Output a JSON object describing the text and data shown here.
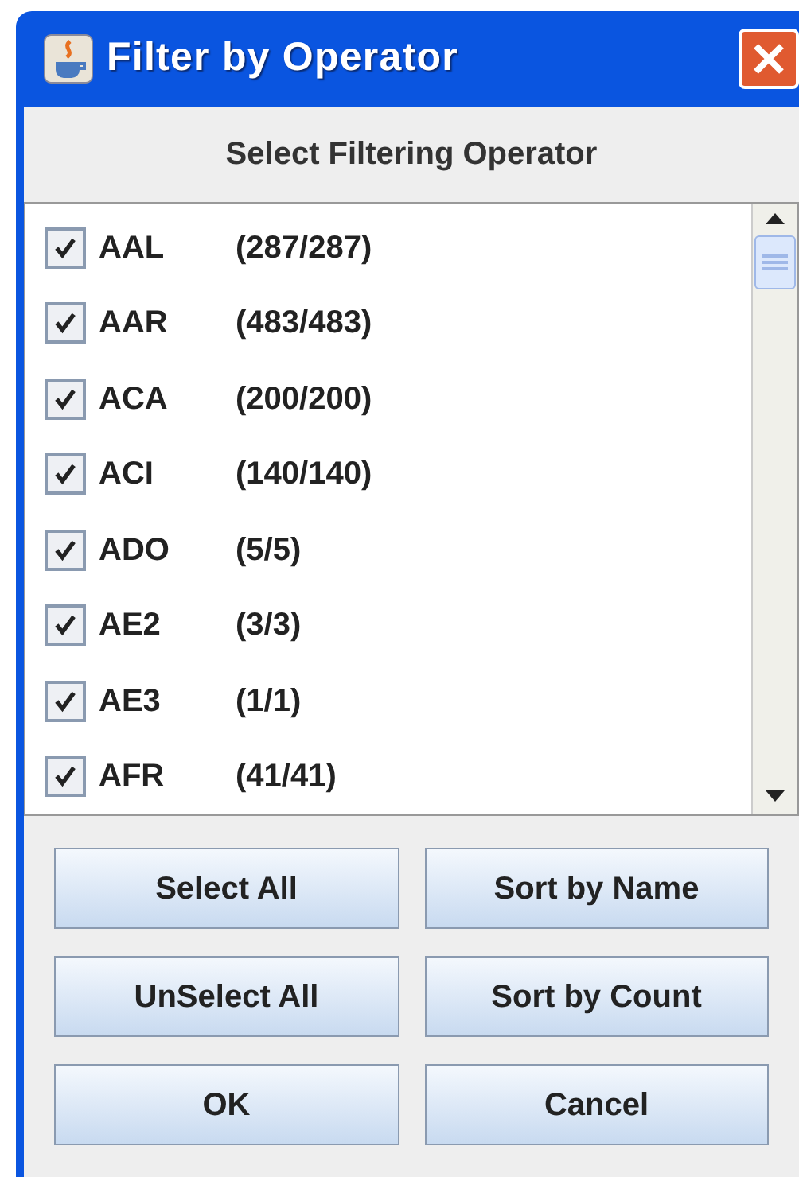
{
  "window": {
    "title": "Filter by Operator"
  },
  "heading": "Select Filtering Operator",
  "operators": [
    {
      "name": "AAL",
      "count": "(287/287)",
      "checked": true
    },
    {
      "name": "AAR",
      "count": "(483/483)",
      "checked": true
    },
    {
      "name": "ACA",
      "count": "(200/200)",
      "checked": true
    },
    {
      "name": "ACI",
      "count": "(140/140)",
      "checked": true
    },
    {
      "name": "ADO",
      "count": "(5/5)",
      "checked": true
    },
    {
      "name": "AE2",
      "count": "(3/3)",
      "checked": true
    },
    {
      "name": "AE3",
      "count": "(1/1)",
      "checked": true
    },
    {
      "name": "AFR",
      "count": "(41/41)",
      "checked": true
    }
  ],
  "buttons": [
    "Select All",
    "Sort by Name",
    "UnSelect All",
    "Sort by Count",
    "OK",
    "Cancel"
  ]
}
